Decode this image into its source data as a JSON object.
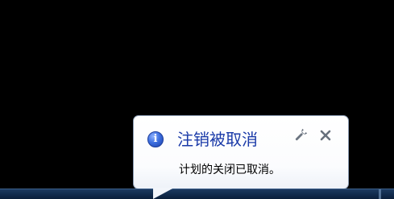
{
  "notification": {
    "title": "注销被取消",
    "message": "计划的关闭已取消。",
    "icon": "info-icon",
    "info_glyph": "i",
    "buttons": {
      "options": "wrench-icon",
      "close": "close-icon"
    }
  },
  "colors": {
    "desktop": "#000000",
    "title": "#1a3aa8",
    "taskbar": "#10294a"
  }
}
